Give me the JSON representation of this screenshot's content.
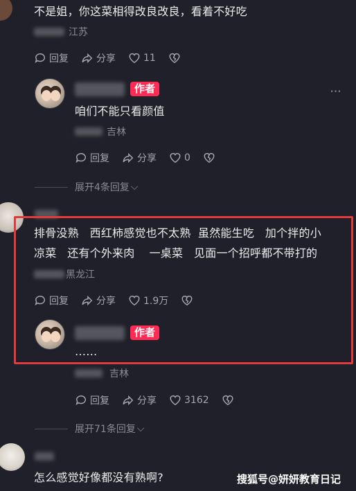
{
  "comments": [
    {
      "text": "不是姐，你这菜相得改良改良，看着不好吃",
      "location": "江苏",
      "actions": {
        "reply": "回复",
        "share": "分享",
        "likes": "11"
      }
    },
    {
      "badge": "作者",
      "text": "咱们不能只看颜值",
      "location": "吉林",
      "actions": {
        "reply": "回复",
        "share": "分享",
        "likes": "0"
      },
      "expand": "展开4条回复"
    },
    {
      "text_line1": "排骨没熟   西红柿感觉也不太熟  虽然能生吃   加个拌的小",
      "text_line2": "凉菜   还有个外来肉    一桌菜   见面一个招呼都不带打的",
      "location": "黑龙江",
      "actions": {
        "reply": "回复",
        "share": "分享",
        "likes": "1.9万"
      }
    },
    {
      "badge": "作者",
      "text": "……",
      "location": "吉林",
      "actions": {
        "reply": "回复",
        "share": "分享",
        "likes": "3162"
      },
      "expand": "展开71条回复"
    },
    {
      "text": "怎么感觉好像都没有熟啊?"
    }
  ],
  "watermark": "搜狐号@妍妍教育日记",
  "colors": {
    "highlight": "#e23b3b",
    "badge": "#fe2c55",
    "background": "#1f2029"
  }
}
